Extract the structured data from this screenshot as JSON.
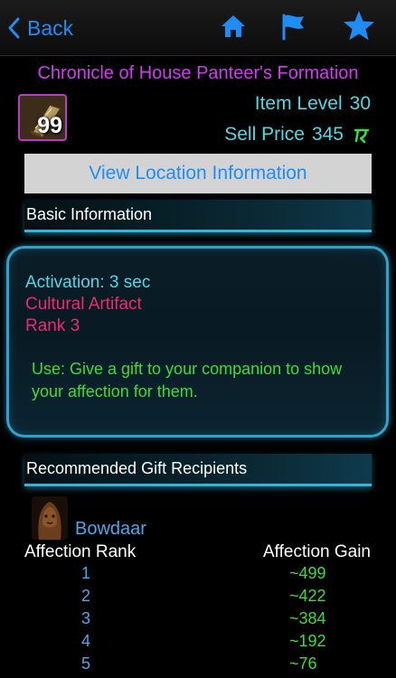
{
  "nav": {
    "back_label": "Back",
    "icons": [
      "home-icon",
      "flag-icon",
      "star-icon"
    ],
    "accent_color": "#1f8df7"
  },
  "item": {
    "title": "Chronicle of House Panteer's Formation",
    "stack_count": "99",
    "level_label": "Item Level",
    "level_value": "30",
    "price_label": "Sell Price",
    "price_value": "345"
  },
  "location_button": "View Location Information",
  "basic_info": {
    "header": "Basic Information",
    "activation": "Activation: 3 sec",
    "type": "Cultural Artifact",
    "rank": "Rank 3",
    "use_text": "Use: Give a gift to your companion to show your affection for them."
  },
  "gift": {
    "header": "Recommended Gift Recipients",
    "recipient": "Bowdaar",
    "col_rank": "Affection Rank",
    "col_gain": "Affection Gain",
    "rows": [
      {
        "rank": "1",
        "gain": "~499"
      },
      {
        "rank": "2",
        "gain": "~422"
      },
      {
        "rank": "3",
        "gain": "~384"
      },
      {
        "rank": "4",
        "gain": "~192"
      },
      {
        "rank": "5",
        "gain": "~76"
      }
    ]
  },
  "colors": {
    "title": "#d33bf2",
    "meta": "#4fd8e6",
    "artifact": "#ec2a6f",
    "use": "#3bdc3b",
    "rank": "#4aa8ee",
    "panel_border": "#2aa3cf"
  }
}
